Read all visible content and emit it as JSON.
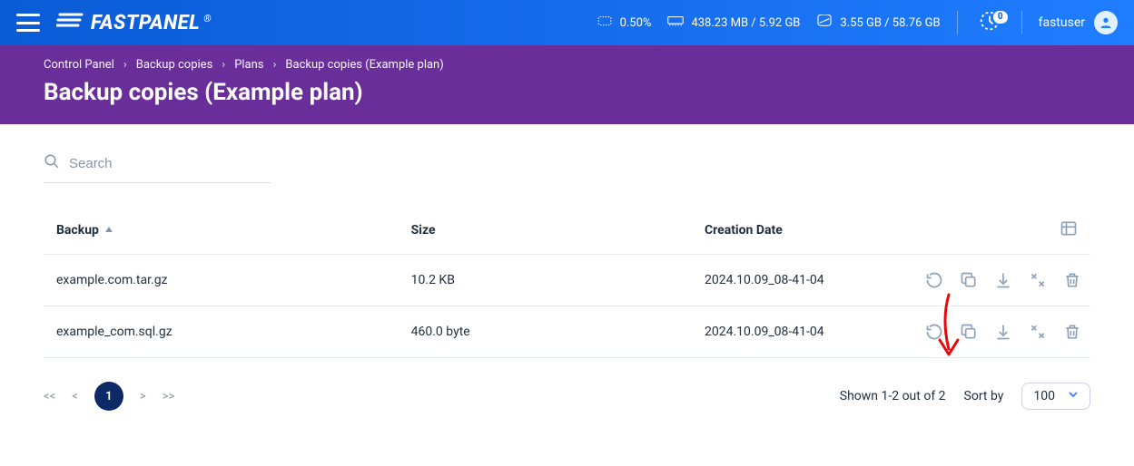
{
  "brand": {
    "name": "FASTPANEL",
    "reg": "®"
  },
  "topbar": {
    "cpu": "0.50%",
    "mem": "438.23 MB / 5.92 GB",
    "disk": "3.55 GB / 58.76 GB",
    "notifications": "0",
    "username": "fastuser"
  },
  "breadcrumbs": [
    "Control Panel",
    "Backup copies",
    "Plans",
    "Backup copies (Example plan)"
  ],
  "page_title": "Backup copies (Example plan)",
  "search": {
    "placeholder": "Search"
  },
  "table": {
    "columns": {
      "backup": "Backup",
      "size": "Size",
      "created": "Creation Date"
    },
    "rows": [
      {
        "name": "example.com.tar.gz",
        "size": "10.2 KB",
        "created": "2024.10.09_08-41-04"
      },
      {
        "name": "example_com.sql.gz",
        "size": "460.0 byte",
        "created": "2024.10.09_08-41-04"
      }
    ]
  },
  "pagination": {
    "first": "<<",
    "prev": "<",
    "current": "1",
    "next": ">",
    "last": ">>",
    "shown": "Shown 1-2 out of 2",
    "sortby_label": "Sort by",
    "page_size": "100"
  },
  "chevron": "›"
}
